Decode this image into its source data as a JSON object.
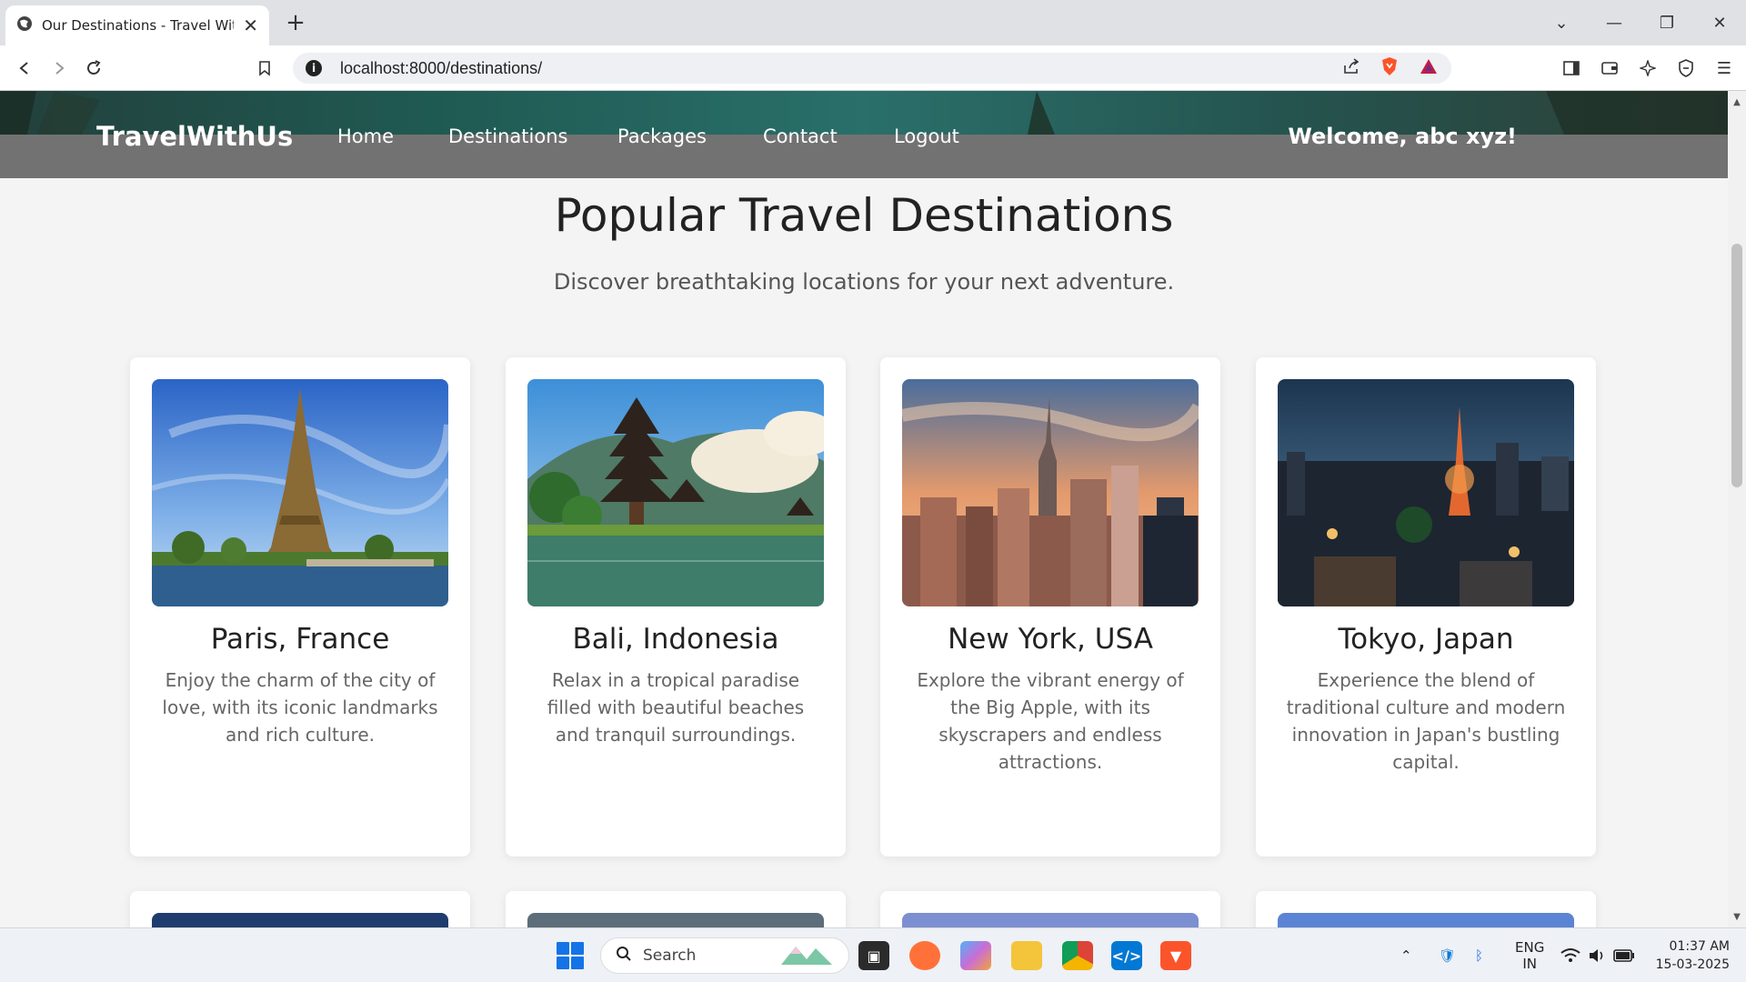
{
  "browser": {
    "tab_title": "Our Destinations - Travel With",
    "url": "localhost:8000/destinations/"
  },
  "site": {
    "logo": "TravelWithUs",
    "nav": [
      "Home",
      "Destinations",
      "Packages",
      "Contact",
      "Logout"
    ],
    "welcome": "Welcome, abc xyz!"
  },
  "page": {
    "title": "Popular Travel Destinations",
    "subtitle": "Discover breathtaking locations for your next adventure."
  },
  "destinations": [
    {
      "name": "Paris, France",
      "description": "Enjoy the charm of the city of love, with its iconic landmarks and rich culture.",
      "image": "eiffel-tower-photo"
    },
    {
      "name": "Bali, Indonesia",
      "description": "Relax in a tropical paradise filled with beautiful beaches and tranquil surroundings.",
      "image": "bali-temple-photo"
    },
    {
      "name": "New York, USA",
      "description": "Explore the vibrant energy of the Big Apple, with its skyscrapers and endless attractions.",
      "image": "new-york-skyline-photo"
    },
    {
      "name": "Tokyo, Japan",
      "description": "Experience the blend of traditional culture and modern innovation in Japan's bustling capital.",
      "image": "tokyo-night-photo"
    }
  ],
  "taskbar": {
    "search_placeholder": "Search",
    "lang_line1": "ENG",
    "lang_line2": "IN",
    "time": "01:37 AM",
    "date": "15-03-2025"
  }
}
